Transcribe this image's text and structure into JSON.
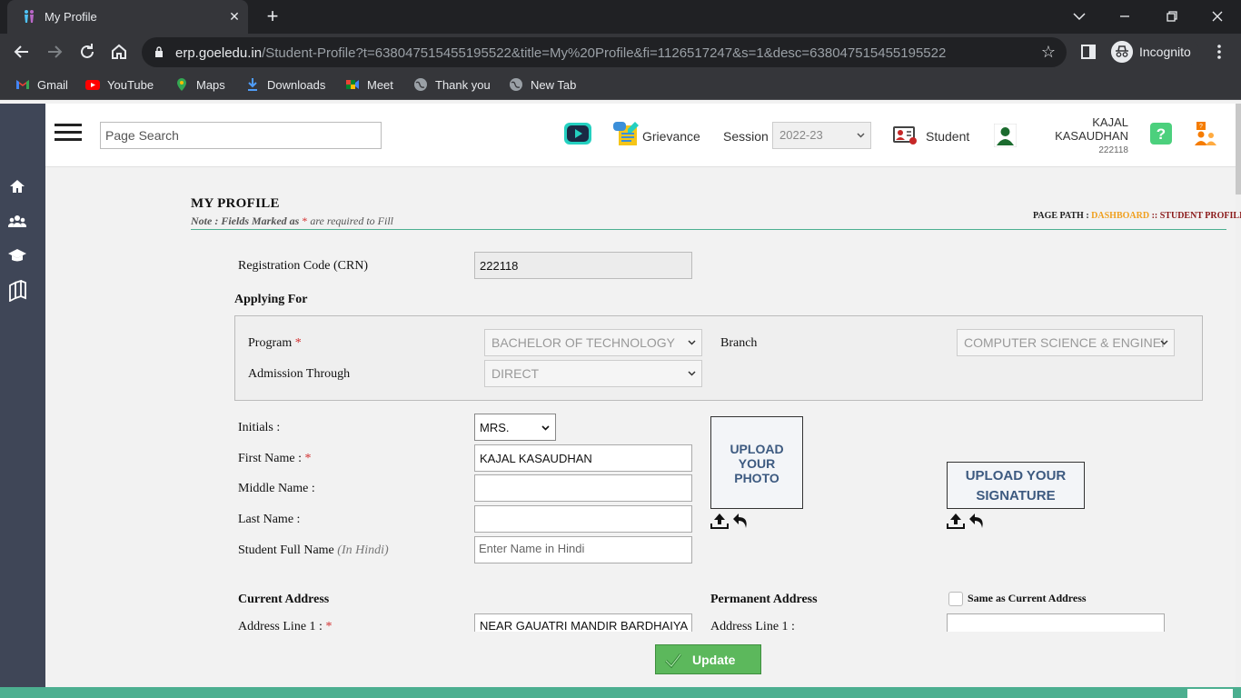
{
  "browser": {
    "tab_title": "My Profile",
    "url_host": "erp.goeledu.in",
    "url_path": "/Student-Profile?t=638047515455195522&title=My%20Profile&fi=1126517247&s=1&desc=638047515455195522",
    "incognito_label": "Incognito",
    "bookmarks": [
      "Gmail",
      "YouTube",
      "Maps",
      "Downloads",
      "Meet",
      "Thank you",
      "New Tab"
    ]
  },
  "header": {
    "search_placeholder": "Page Search",
    "grievance_label": "Grievance",
    "session_label": "Session",
    "session_value": "2022-23",
    "role_label": "Student",
    "user_name": "KAJAL KASAUDHAN",
    "user_code": "222118"
  },
  "page": {
    "title": "MY PROFILE",
    "note_prefix": "Note : Fields Marked as",
    "note_star": "*",
    "note_suffix": "are required to Fill",
    "path_label": "PAGE PATH :",
    "path_dashboard": "DASHBOARD",
    "path_sep": "::",
    "path_current": "STUDENT PROFILE"
  },
  "form": {
    "crn_label": "Registration Code (CRN)",
    "crn_value": "222118",
    "applying_for": "Applying For",
    "program_label": "Program",
    "program_value": "BACHELOR OF TECHNOLOGY",
    "branch_label": "Branch",
    "branch_value": "COMPUTER SCIENCE & ENGINEI",
    "admission_label": "Admission Through",
    "admission_value": "DIRECT",
    "initials_label": "Initials :",
    "initials_value": "MRS.",
    "first_name_label": "First Name :",
    "first_name_value": "KAJAL KASAUDHAN",
    "middle_name_label": "Middle Name :",
    "middle_name_value": "",
    "last_name_label": "Last Name :",
    "last_name_value": "",
    "hindi_name_label": "Student Full Name",
    "hindi_name_hint": "(In Hindi)",
    "hindi_name_placeholder": "Enter Name in Hindi",
    "upload_photo": [
      "UPLOAD",
      "YOUR",
      "PHOTO"
    ],
    "upload_signature": [
      "UPLOAD YOUR",
      "SIGNATURE"
    ],
    "current_address": "Current Address",
    "address_line1_label": "Address Line 1 :",
    "address_line1_value": "NEAR GAUATRI MANDIR BARDHAIYA",
    "permanent_address": "Permanent Address",
    "perm_address_line1_label": "Address Line 1 :",
    "perm_address_line1_value": "",
    "same_as_current": "Same as Current Address",
    "required_star": "*",
    "update_button": "Update"
  }
}
